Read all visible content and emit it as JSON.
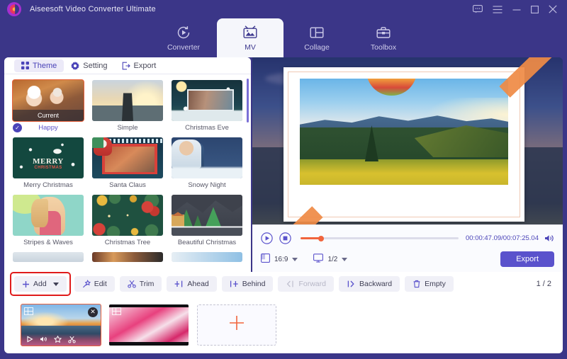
{
  "app": {
    "title": "Aiseesoft Video Converter Ultimate",
    "logo_colors": {
      "accent": "#e8365f",
      "center": "#ffb43a",
      "outer": "#5b2bbf"
    },
    "header_bg": "#3b3688",
    "accent": "#5a52cc",
    "highlight": "#e01b1b"
  },
  "window_controls": [
    {
      "name": "feedback-icon",
      "label": "Feedback"
    },
    {
      "name": "menu-icon",
      "label": "Menu"
    },
    {
      "name": "minimize-icon",
      "label": "Minimize"
    },
    {
      "name": "maximize-icon",
      "label": "Maximize"
    },
    {
      "name": "close-icon",
      "label": "Close"
    }
  ],
  "module_tabs": [
    {
      "label": "Converter",
      "icon": "converter-icon",
      "active": false
    },
    {
      "label": "MV",
      "icon": "mv-icon",
      "active": true
    },
    {
      "label": "Collage",
      "icon": "collage-icon",
      "active": false
    },
    {
      "label": "Toolbox",
      "icon": "toolbox-icon",
      "active": false
    }
  ],
  "left_panel": {
    "tabs": [
      {
        "label": "Theme",
        "icon": "grid-icon",
        "active": true
      },
      {
        "label": "Setting",
        "icon": "gear-icon",
        "active": false
      },
      {
        "label": "Export",
        "icon": "export-icon",
        "active": false
      }
    ],
    "themes": [
      {
        "label": "Happy",
        "selected": true,
        "badge": "Current"
      },
      {
        "label": "Simple",
        "selected": false,
        "badge": ""
      },
      {
        "label": "Christmas Eve",
        "selected": false,
        "badge": ""
      },
      {
        "label": "Merry Christmas",
        "selected": false,
        "badge": ""
      },
      {
        "label": "Santa Claus",
        "selected": false,
        "badge": ""
      },
      {
        "label": "Snowy Night",
        "selected": false,
        "badge": ""
      },
      {
        "label": "Stripes & Waves",
        "selected": false,
        "badge": ""
      },
      {
        "label": "Christmas Tree",
        "selected": false,
        "badge": ""
      },
      {
        "label": "Beautiful Christmas",
        "selected": false,
        "badge": ""
      }
    ]
  },
  "player": {
    "play_icon": "play-circle-icon",
    "stop_icon": "stop-circle-icon",
    "timecode": "00:00:47.09/00:07:25.04",
    "progress_percent": 13,
    "volume_icon": "volume-icon",
    "aspect_ratio": "16:9",
    "aspect_icon": "aspect-ratio-icon",
    "zoom_level": "1/2",
    "zoom_icon": "monitor-icon",
    "export_label": "Export"
  },
  "toolbar": {
    "add_label": "Add",
    "add_icon": "plus-icon",
    "add_caret": "chevron-down-icon",
    "add_highlighted": true,
    "buttons": [
      {
        "label": "Edit",
        "icon": "magic-wand-icon",
        "disabled": false
      },
      {
        "label": "Trim",
        "icon": "scissors-icon",
        "disabled": false
      },
      {
        "label": "Ahead",
        "icon": "insert-ahead-icon",
        "disabled": false
      },
      {
        "label": "Behind",
        "icon": "insert-behind-icon",
        "disabled": false
      },
      {
        "label": "Forward",
        "icon": "move-forward-icon",
        "disabled": true
      },
      {
        "label": "Backward",
        "icon": "move-backward-icon",
        "disabled": false
      },
      {
        "label": "Empty",
        "icon": "trash-icon",
        "disabled": false
      }
    ],
    "page_indicator": "1 / 2"
  },
  "timeline": {
    "clips": [
      {
        "name": "clip-1",
        "selected": true,
        "close_icon": "close-icon",
        "tools": [
          "play-icon",
          "volume-icon",
          "effect-icon",
          "trim-icon"
        ]
      },
      {
        "name": "clip-2",
        "selected": false,
        "close_icon": "",
        "tools": []
      }
    ],
    "add_clip_icon": "plus-icon",
    "add_clip_label": ""
  }
}
